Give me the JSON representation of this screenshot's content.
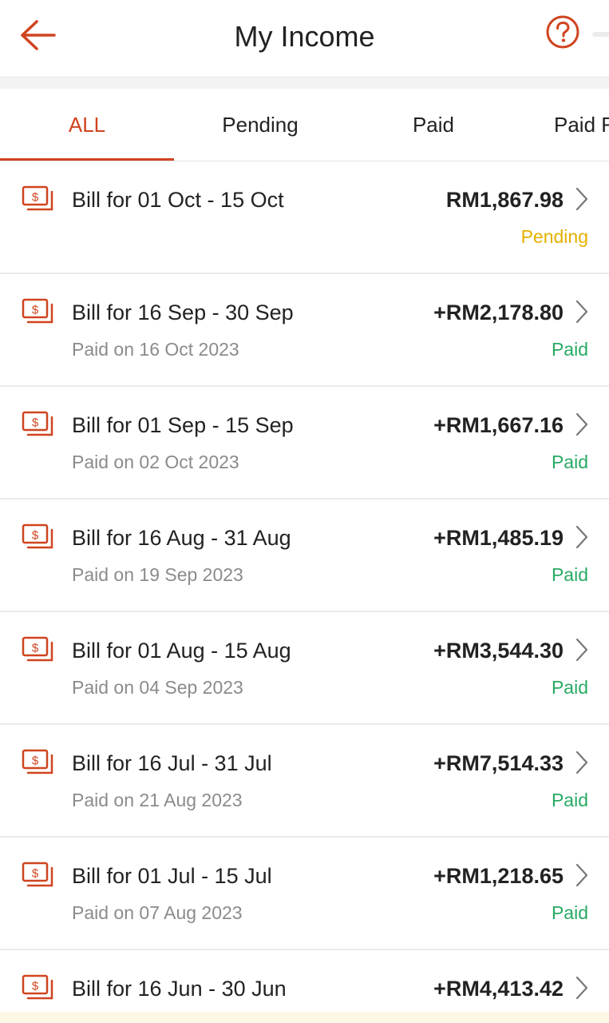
{
  "header": {
    "title": "My Income",
    "back_icon": "arrow-left-icon",
    "help_icon": "question-circle-icon",
    "accent_color": "#d0441f"
  },
  "tabs": [
    {
      "label": "ALL",
      "active": true
    },
    {
      "label": "Pending",
      "active": false
    },
    {
      "label": "Paid",
      "active": false
    },
    {
      "label": "Paid F",
      "active": false
    }
  ],
  "bills": [
    {
      "title": "Bill for 01 Oct - 15 Oct",
      "amount": "RM1,867.98",
      "date": "",
      "status": "Pending"
    },
    {
      "title": "Bill for 16 Sep - 30 Sep",
      "amount": "+RM2,178.80",
      "date": "Paid on 16 Oct 2023",
      "status": "Paid"
    },
    {
      "title": "Bill for 01 Sep - 15 Sep",
      "amount": "+RM1,667.16",
      "date": "Paid on 02 Oct 2023",
      "status": "Paid"
    },
    {
      "title": "Bill for 16 Aug - 31 Aug",
      "amount": "+RM1,485.19",
      "date": "Paid on 19 Sep 2023",
      "status": "Paid"
    },
    {
      "title": "Bill for 01 Aug - 15 Aug",
      "amount": "+RM3,544.30",
      "date": "Paid on 04 Sep 2023",
      "status": "Paid"
    },
    {
      "title": "Bill for 16 Jul - 31 Jul",
      "amount": "+RM7,514.33",
      "date": "Paid on 21 Aug 2023",
      "status": "Paid"
    },
    {
      "title": "Bill for 01 Jul - 15 Jul",
      "amount": "+RM1,218.65",
      "date": "Paid on 07 Aug 2023",
      "status": "Paid"
    },
    {
      "title": "Bill for 16 Jun - 30 Jun",
      "amount": "+RM4,413.42",
      "date": "",
      "status": ""
    }
  ],
  "colors": {
    "paid": "#26aa63",
    "pending": "#e4b000",
    "icon": "#d0441f"
  },
  "icons": {
    "bill": "money-bill-icon",
    "chevron": "chevron-right-icon"
  }
}
